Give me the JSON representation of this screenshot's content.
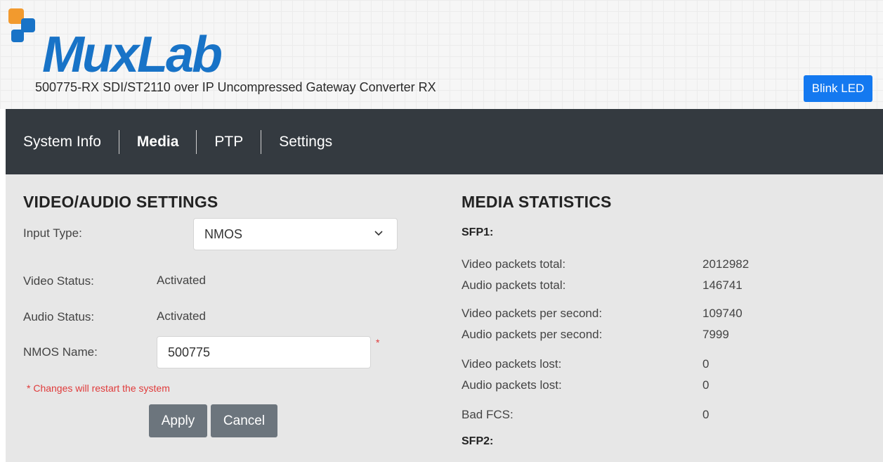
{
  "header": {
    "logo_text": "MuxLab",
    "subtitle": "500775-RX SDI/ST2110 over IP Uncompressed Gateway Converter RX",
    "blink_label": "Blink LED"
  },
  "nav": {
    "items": [
      {
        "label": "System Info",
        "active": false
      },
      {
        "label": "Media",
        "active": true
      },
      {
        "label": "PTP",
        "active": false
      },
      {
        "label": "Settings",
        "active": false
      }
    ]
  },
  "settings": {
    "title": "VIDEO/AUDIO SETTINGS",
    "input_type_label": "Input Type:",
    "input_type_value": "NMOS",
    "video_status_label": "Video Status:",
    "video_status_value": "Activated",
    "audio_status_label": "Audio Status:",
    "audio_status_value": "Activated",
    "nmos_name_label": "NMOS Name:",
    "nmos_name_value": "500775",
    "required_mark": "*",
    "warning": "* Changes will restart the system",
    "apply_label": "Apply",
    "cancel_label": "Cancel"
  },
  "stats": {
    "title": "MEDIA STATISTICS",
    "sfp1_label": "SFP1:",
    "sfp2_label": "SFP2:",
    "rows": [
      {
        "label": "Video packets total:",
        "value": "2012982"
      },
      {
        "label": "Audio packets total:",
        "value": "146741"
      },
      {
        "label": "Video packets per second:",
        "value": "109740"
      },
      {
        "label": "Audio packets per second:",
        "value": "7999"
      },
      {
        "label": "Video packets lost:",
        "value": "0"
      },
      {
        "label": "Audio packets lost:",
        "value": "0"
      },
      {
        "label": "Bad FCS:",
        "value": "0"
      }
    ]
  },
  "colors": {
    "accent": "#1479f0",
    "nav_bg": "#343a40",
    "logo_blue": "#1873c7",
    "logo_orange": "#f29a2e"
  }
}
